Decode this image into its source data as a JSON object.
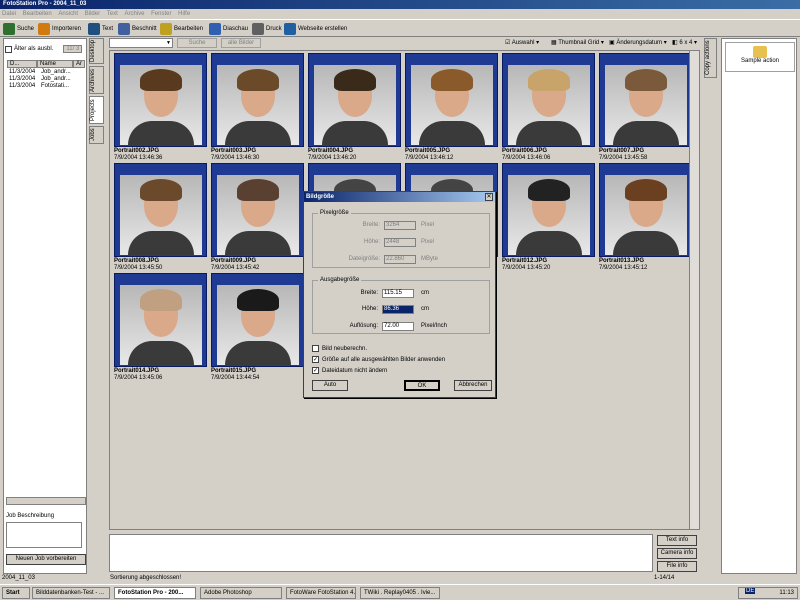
{
  "window": {
    "title": "FotoStation Pro - 2004_11_03"
  },
  "menu": [
    "Datei",
    "Bearbeiten",
    "Ansicht",
    "Bilder",
    "Text",
    "Archive",
    "Fenster",
    "Hilfe"
  ],
  "toolbar": [
    {
      "label": "Suche",
      "icon": "eye-icon",
      "color": "#2f6f2f"
    },
    {
      "label": "Importeren",
      "icon": "import-icon",
      "color": "#d07a10"
    },
    {
      "label": "Text",
      "icon": "pen-icon",
      "color": "#205080"
    },
    {
      "label": "Beschnitt",
      "icon": "crop-icon",
      "color": "#4060a0"
    },
    {
      "label": "Bearbeiten",
      "icon": "edit-icon",
      "color": "#c0a020"
    },
    {
      "label": "Diaschau",
      "icon": "slideshow-icon",
      "color": "#3060b0"
    },
    {
      "label": "Druck",
      "icon": "printer-icon",
      "color": "#606060"
    },
    {
      "label": "Webseite erstellen",
      "icon": "globe-icon",
      "color": "#2060a0"
    }
  ],
  "left": {
    "older_label": "Älter als ausbl.",
    "older_value": "11/ 3",
    "headers": [
      "D...",
      "Name",
      "Ar"
    ],
    "jobs": [
      {
        "date": "11/3/2004",
        "name": "Job_andr..."
      },
      {
        "date": "11/3/2004",
        "name": "Job_andr..."
      },
      {
        "date": "11/3/2004",
        "name": "Fotostati..."
      }
    ],
    "job_desc_label": "Job Beschreibung",
    "new_job": "Neuen Job vorbereiten"
  },
  "vtabs": [
    "Desktop",
    "Archives",
    "Projects",
    "Jobs"
  ],
  "gridtop": {
    "search": "Suche",
    "all": "alle Bilder",
    "selection": "Auswahl",
    "view": "Thumbnail Grid",
    "sort": "Änderungsdatum",
    "size": "6 x 4"
  },
  "thumbs": [
    {
      "name": "Portrait002.JPG",
      "date": "7/9/2004 13:46:36"
    },
    {
      "name": "Portrait003.JPG",
      "date": "7/9/2004 13:46:30"
    },
    {
      "name": "Portrait004.JPG",
      "date": "7/9/2004 13:46:20"
    },
    {
      "name": "Portrait005.JPG",
      "date": "7/9/2004 13:46:12"
    },
    {
      "name": "Portrait006.JPG",
      "date": "7/9/2004 13:46:06"
    },
    {
      "name": "Portrait007.JPG",
      "date": "7/9/2004 13:45:58"
    },
    {
      "name": "Portrait008.JPG",
      "date": "7/9/2004 13:45:50"
    },
    {
      "name": "Portrait009.JPG",
      "date": "7/9/2004 13:45:42"
    },
    {
      "name": "",
      "date": ""
    },
    {
      "name": "",
      "date": ""
    },
    {
      "name": "Portrait012.JPG",
      "date": "7/9/2004 13:45:20"
    },
    {
      "name": "Portrait013.JPG",
      "date": "7/9/2004 13:45:12"
    },
    {
      "name": "Portrait014.JPG",
      "date": "7/9/2004 13:45:06"
    },
    {
      "name": "Portrait015.JPG",
      "date": "7/9/2004 13:44:54"
    }
  ],
  "dialog": {
    "title": "Bildgröße",
    "pixel_group": "Pixelgröße",
    "width_label": "Breite:",
    "width_px": "3264",
    "unit_px": "Pixel",
    "height_label": "Höhe:",
    "height_px": "2448",
    "filesize_label": "Dateigröße:",
    "filesize": "22.860",
    "unit_mb": "MByte",
    "output_group": "Ausgabegröße",
    "out_width": "115.15",
    "unit_cm": "cm",
    "out_height": "86.36",
    "res_label": "Auflösung:",
    "res": "72.00",
    "unit_ppi": "Pixel/Inch",
    "chk_resample": "Bild neuberechn.",
    "chk_apply_all": "Größe auf alle ausgewählten Bilder anwenden",
    "chk_keep_date": "Dateidatum nicht ändern",
    "auto": "Auto",
    "ok": "OK",
    "cancel": "Abbrechen"
  },
  "right": {
    "tab": "Copy actions",
    "action": "Sample action"
  },
  "info_buttons": [
    "Text info",
    "Camera info",
    "File info"
  ],
  "status": {
    "left": "2004_11_03",
    "mid": "Sortierung abgeschlossen!",
    "count": "1-14/14"
  },
  "taskbar": {
    "start": "Start",
    "tasks": [
      "Bilddatenbanken-Test - ...",
      "FotoStation Pro - 200...",
      "Adobe Photoshop",
      "FotoWare FotoStation 4....",
      "TWiki . Replay0405 . Ivie..."
    ],
    "lang": "DE",
    "time": "11:13"
  }
}
